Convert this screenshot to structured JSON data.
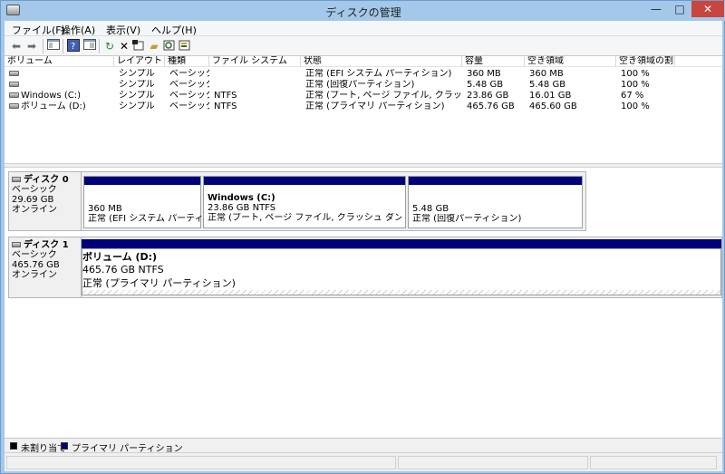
{
  "window": {
    "title": "ディスクの管理",
    "minimize": "—",
    "maximize": "□",
    "close": "✕"
  },
  "menu": [
    "ファイル(F)",
    "操作(A)",
    "表示(V)",
    "ヘルプ(H)"
  ],
  "toolbar": [
    "back-icon",
    "forward-icon",
    "console-tree-icon",
    "help-icon",
    "properties-icon",
    "refresh-icon",
    "delete-icon",
    "settings-icon",
    "open-folder-icon",
    "search-icon",
    "export-icon"
  ],
  "columns": [
    "ボリューム",
    "レイアウト",
    "種類",
    "ファイル システム",
    "状態",
    "容量",
    "空き領域",
    "空き領域の割..."
  ],
  "volumes": [
    {
      "name": "",
      "layout": "シンプル",
      "type": "ベーシック",
      "fs": "",
      "status": "正常 (EFI システム パーティション)",
      "capacity": "360 MB",
      "free": "360 MB",
      "pct": "100 %"
    },
    {
      "name": "",
      "layout": "シンプル",
      "type": "ベーシック",
      "fs": "",
      "status": "正常 (回復パーティション)",
      "capacity": "5.48 GB",
      "free": "5.48 GB",
      "pct": "100 %"
    },
    {
      "name": "Windows (C:)",
      "layout": "シンプル",
      "type": "ベーシック",
      "fs": "NTFS",
      "status": "正常 (ブート, ページ ファイル, クラッシュ ダンプ, ...",
      "capacity": "23.86 GB",
      "free": "16.01 GB",
      "pct": "67 %"
    },
    {
      "name": "ボリューム (D:)",
      "layout": "シンプル",
      "type": "ベーシック",
      "fs": "NTFS",
      "status": "正常 (プライマリ パーティション)",
      "capacity": "465.76 GB",
      "free": "465.60 GB",
      "pct": "100 %"
    }
  ],
  "disks": [
    {
      "name": "ディスク 0",
      "type": "ベーシック",
      "size": "29.69 GB",
      "state": "オンライン",
      "partitions": [
        {
          "title": "",
          "size": "360 MB",
          "status": "正常 (EFI システム パーティション)"
        },
        {
          "title": "Windows (C:)",
          "size": "23.86 GB NTFS",
          "status": "正常 (ブート, ページ ファイル, クラッシュ ダンプ, Wim ブート, プ"
        },
        {
          "title": "",
          "size": "5.48 GB",
          "status": "正常 (回復パーティション)"
        }
      ]
    },
    {
      "name": "ディスク 1",
      "type": "ベーシック",
      "size": "465.76 GB",
      "state": "オンライン",
      "partitions": [
        {
          "title": "ボリューム (D:)",
          "size": "465.76 GB NTFS",
          "status": "正常 (プライマリ パーティション)"
        }
      ]
    }
  ],
  "legend": [
    {
      "label": "未割り当て",
      "color": "#000000"
    },
    {
      "label": "プライマリ パーティション",
      "color": "#00007a"
    }
  ]
}
